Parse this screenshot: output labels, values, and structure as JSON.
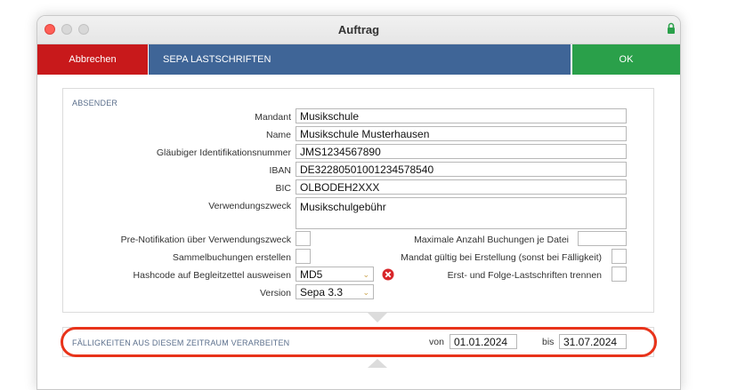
{
  "window": {
    "title": "Auftrag"
  },
  "toolbar": {
    "cancel_label": "Abbrechen",
    "section_title": "SEPA LASTSCHRIFTEN",
    "ok_label": "OK",
    "colors": {
      "cancel": "#c8191b",
      "title": "#3f6597",
      "ok": "#2aa04a"
    }
  },
  "absender": {
    "section_label": "ABSENDER",
    "fields": [
      {
        "label": "Mandant",
        "value": "Musikschule"
      },
      {
        "label": "Name",
        "value": "Musikschule Musterhausen"
      },
      {
        "label": "Gläubiger Identifikationsnummer",
        "value": "JMS1234567890"
      },
      {
        "label": "IBAN",
        "value": "DE32280501001234578540"
      },
      {
        "label": "BIC",
        "value": "OLBODEH2XXX"
      },
      {
        "label": "Verwendungszweck",
        "value": "Musikschulgebühr"
      }
    ],
    "options_left": [
      {
        "label": "Pre-Notifikation über Verwendungszweck",
        "checked": false
      },
      {
        "label": "Sammelbuchungen erstellen",
        "checked": false
      },
      {
        "label": "Hashcode auf Begleitzettel ausweisen",
        "value": "MD5"
      },
      {
        "label": "Version",
        "value": "Sepa 3.3"
      }
    ],
    "options_right": [
      {
        "label": "Maximale Anzahl Buchungen je Datei",
        "value": ""
      },
      {
        "label": "Mandat gültig bei Erstellung (sonst bei Fälligkeit)",
        "checked": false
      },
      {
        "label": "Erst- und Folge-Lastschriften trennen",
        "checked": false
      }
    ]
  },
  "range": {
    "label": "FÄLLIGKEITEN AUS DIESEM ZEITRAUM VERARBEITEN",
    "from_label": "von",
    "from_value": "01.01.2024",
    "to_label": "bis",
    "to_value": "31.07.2024"
  },
  "icons": {
    "lock": "lock-icon",
    "error": "error-icon",
    "dropdown": "chevron-down-icon"
  }
}
